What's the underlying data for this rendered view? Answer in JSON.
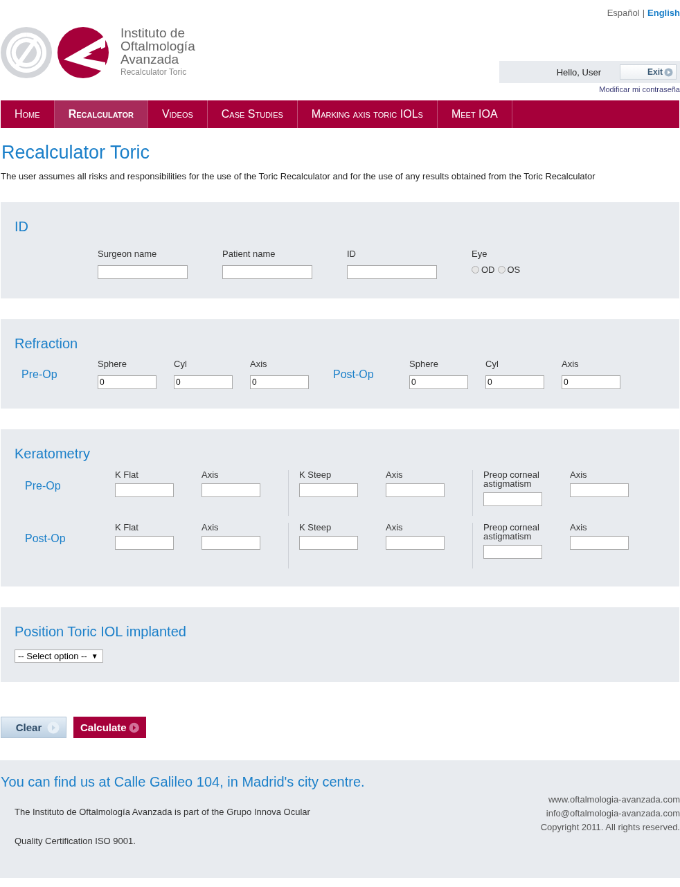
{
  "header": {
    "language_separator": "|",
    "languages": [
      {
        "label": "Español",
        "selected": false
      },
      {
        "label": "English",
        "selected": true
      }
    ],
    "logo": {
      "lines": [
        "Instituto de",
        "Oftalmología",
        "Avanzada"
      ],
      "subtitle": "Recalculator Toric"
    },
    "user": {
      "greeting": "Hello, User",
      "exit": "Exit",
      "change_password": "Modificar mi contraseña"
    }
  },
  "nav": [
    {
      "label": "Home",
      "selected": false
    },
    {
      "label": "Recalculator",
      "selected": true
    },
    {
      "label": "Videos",
      "selected": false
    },
    {
      "label": "Case Studies",
      "selected": false
    },
    {
      "label": "Marking axis toric IOLs",
      "selected": false
    },
    {
      "label": "Meet IOA",
      "selected": false
    }
  ],
  "page_title": "Recalculator Toric",
  "disclaimer": "The user assumes all risks and responsibilities for the use of the Toric Recalculator and for the use of any results obtained from the Toric Recalculator",
  "id_section": {
    "title": "ID",
    "fields": [
      {
        "label": "Surgeon name"
      },
      {
        "label": "Patient name"
      },
      {
        "label": "ID"
      }
    ],
    "eye": {
      "label": "Eye",
      "options": [
        {
          "label": "OD",
          "selected": false
        },
        {
          "label": "OS",
          "selected": false
        }
      ]
    }
  },
  "refraction": {
    "title": "Refraction",
    "groups": [
      {
        "label": "Pre-Op",
        "fields": [
          {
            "label": "Sphere",
            "value": "0"
          },
          {
            "label": "Cyl",
            "value": "0"
          },
          {
            "label": "Axis",
            "value": "0"
          }
        ]
      },
      {
        "label": "Post-Op",
        "fields": [
          {
            "label": "Sphere",
            "value": "0"
          },
          {
            "label": "Cyl",
            "value": "0"
          },
          {
            "label": "Axis",
            "value": "0"
          }
        ]
      }
    ]
  },
  "keratometry": {
    "title": "Keratometry",
    "rows": [
      {
        "label": "Pre-Op",
        "groups": [
          [
            {
              "label": "K Flat"
            },
            {
              "label": "Axis"
            }
          ],
          [
            {
              "label": "K Steep"
            },
            {
              "label": "Axis"
            }
          ],
          [
            {
              "label": "Preop corneal astigmatism"
            },
            {
              "label": "Axis"
            }
          ]
        ]
      },
      {
        "label": "Post-Op",
        "groups": [
          [
            {
              "label": "K Flat"
            },
            {
              "label": "Axis"
            }
          ],
          [
            {
              "label": "K Steep"
            },
            {
              "label": "Axis"
            }
          ],
          [
            {
              "label": "Preop corneal astigmatism"
            },
            {
              "label": "Axis"
            }
          ]
        ]
      }
    ]
  },
  "position": {
    "title": "Position Toric IOL implanted",
    "select": "-- Select option --",
    "caret": "▼"
  },
  "buttons": [
    {
      "label": "Clear",
      "kind": "secondary"
    },
    {
      "label": "Calculate",
      "kind": "primary"
    }
  ],
  "footer": {
    "headline": "You can find us at Calle Galileo 104, in Madrid's city centre.",
    "notes": [
      "The Instituto de Oftalmología Avanzada is part of the Grupo Innova Ocular",
      "Quality Certification ISO 9001."
    ],
    "contact": [
      "www.oftalmologia-avanzada.com",
      "info@oftalmologia-avanzada.com",
      "Copyright 2011. All rights reserved."
    ]
  }
}
